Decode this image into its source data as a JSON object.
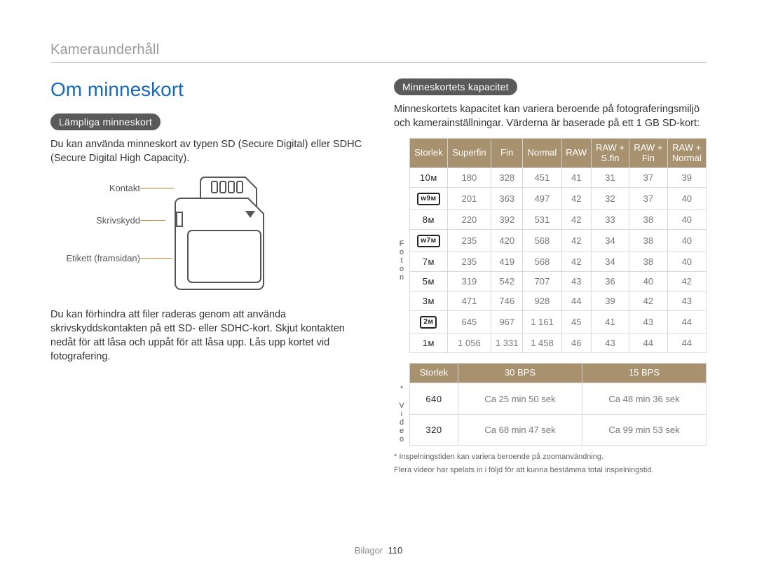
{
  "running_head": "Kameraunderhåll",
  "footer": {
    "section": "Bilagor",
    "page_number": "110"
  },
  "left": {
    "title": "Om minneskort",
    "pill": "Lämpliga minneskort",
    "p1": "Du kan använda minneskort av typen SD (Secure Digital) eller SDHC (Secure Digital High Capacity).",
    "labels": {
      "contact": "Kontakt",
      "write_protect": "Skrivskydd",
      "front_label": "Etikett (framsidan)"
    },
    "p2": "Du kan förhindra att filer raderas genom att använda skrivskyddskontakten på ett SD- eller SDHC-kort. Skjut kontakten nedåt för att låsa och uppåt för att låsa upp. Lås upp kortet vid fotografering."
  },
  "right": {
    "pill": "Minneskortets kapacitet",
    "intro": "Minneskortets kapacitet kan variera beroende på fotograferingsmiljö och kamerainställningar. Värderna är baserade på ett 1 GB SD-kort:",
    "photo_vert": "Foton",
    "video_vert": "* Video",
    "photo_headers": [
      "Storlek",
      "Superfin",
      "Fin",
      "Normal",
      "RAW",
      "RAW + S.fin",
      "RAW + Fin",
      "RAW + Normal"
    ],
    "photo_rows": [
      {
        "size": "10ᴍ",
        "cells": [
          "180",
          "328",
          "451",
          "41",
          "31",
          "37",
          "39"
        ]
      },
      {
        "size": "ᴡ9ᴍ",
        "cells": [
          "201",
          "363",
          "497",
          "42",
          "32",
          "37",
          "40"
        ]
      },
      {
        "size": "8ᴍ",
        "cells": [
          "220",
          "392",
          "531",
          "42",
          "33",
          "38",
          "40"
        ]
      },
      {
        "size": "ᴡ7ᴍ",
        "cells": [
          "235",
          "420",
          "568",
          "42",
          "34",
          "38",
          "40"
        ]
      },
      {
        "size": "7ᴍ",
        "cells": [
          "235",
          "419",
          "568",
          "42",
          "34",
          "38",
          "40"
        ]
      },
      {
        "size": "5ᴍ",
        "cells": [
          "319",
          "542",
          "707",
          "43",
          "36",
          "40",
          "42"
        ]
      },
      {
        "size": "3ᴍ",
        "cells": [
          "471",
          "746",
          "928",
          "44",
          "39",
          "42",
          "43"
        ]
      },
      {
        "size": "2ᴍ",
        "cells": [
          "645",
          "967",
          "1 161",
          "45",
          "41",
          "43",
          "44"
        ]
      },
      {
        "size": "1ᴍ",
        "cells": [
          "1 056",
          "1 331",
          "1 458",
          "46",
          "43",
          "44",
          "44"
        ]
      }
    ],
    "video_headers": [
      "Storlek",
      "30 BPS",
      "15 BPS"
    ],
    "video_rows": [
      {
        "size": "640",
        "cells": [
          "Ca 25 min 50 sek",
          "Ca 48 min 36 sek"
        ]
      },
      {
        "size": "320",
        "cells": [
          "Ca 68 min 47 sek",
          "Ca 99 min 53 sek"
        ]
      }
    ],
    "notes": [
      "* Inspelningstiden kan variera beroende på zoomanvändning.",
      "Flera videor har spelats in i följd för att kunna bestämma total inspelningstid."
    ]
  },
  "chart_data": [
    {
      "type": "table",
      "title": "Foton – kapacitet (antal bilder på 1 GB SD-kort)",
      "columns": [
        "Storlek",
        "Superfin",
        "Fin",
        "Normal",
        "RAW",
        "RAW + S.fin",
        "RAW + Fin",
        "RAW + Normal"
      ],
      "rows": [
        [
          "10M",
          180,
          328,
          451,
          41,
          31,
          37,
          39
        ],
        [
          "W9M",
          201,
          363,
          497,
          42,
          32,
          37,
          40
        ],
        [
          "8M",
          220,
          392,
          531,
          42,
          33,
          38,
          40
        ],
        [
          "W7M",
          235,
          420,
          568,
          42,
          34,
          38,
          40
        ],
        [
          "7M",
          235,
          419,
          568,
          42,
          34,
          38,
          40
        ],
        [
          "5M",
          319,
          542,
          707,
          43,
          36,
          40,
          42
        ],
        [
          "3M",
          471,
          746,
          928,
          44,
          39,
          42,
          43
        ],
        [
          "2M",
          645,
          967,
          1161,
          45,
          41,
          43,
          44
        ],
        [
          "1M",
          1056,
          1331,
          1458,
          46,
          43,
          44,
          44
        ]
      ]
    },
    {
      "type": "table",
      "title": "Video – inspelningstid (1 GB SD-kort)",
      "columns": [
        "Storlek",
        "30 BPS",
        "15 BPS"
      ],
      "rows": [
        [
          "640",
          "Ca 25 min 50 sek",
          "Ca 48 min 36 sek"
        ],
        [
          "320",
          "Ca 68 min 47 sek",
          "Ca 99 min 53 sek"
        ]
      ]
    }
  ]
}
